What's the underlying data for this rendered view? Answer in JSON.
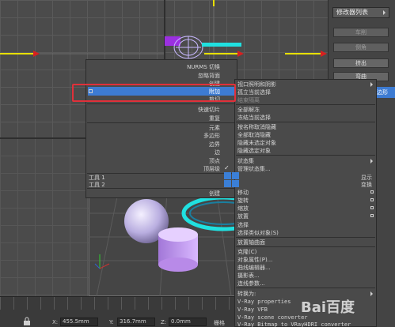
{
  "command_panel": {
    "title": "修改器列表",
    "buttons": [
      "车削",
      "倒角",
      "挤出",
      "弯曲"
    ],
    "highlight_text": "边形"
  },
  "quad_left": {
    "items": [
      {
        "label": "NURMS 切换"
      },
      {
        "label": "忽略背面"
      },
      {
        "label": "创建"
      },
      {
        "label": "附加",
        "selected": true
      },
      {
        "label": "剪切"
      },
      {
        "label": "快速切片"
      },
      {
        "label": "重复"
      },
      {
        "label": "元素"
      },
      {
        "label": "多边形"
      },
      {
        "label": "边界"
      },
      {
        "label": "边"
      },
      {
        "label": "顶点"
      },
      {
        "label": "顶层级"
      }
    ],
    "tool1": "工具 1",
    "tool2": "工具 2",
    "bottom": "创建"
  },
  "quad_right": {
    "top_items": [
      "视口照明和阴影",
      "孤立当前选择",
      "结束隔离",
      "全部解冻",
      "冻结当前选择",
      "按名称取消隐藏",
      "全部取消隐藏",
      "隐藏未选定对象",
      "隐藏选定对象",
      "状态集",
      "管理状态集..."
    ],
    "display": "显示",
    "transform": "变换",
    "bottom_items": [
      "移动",
      "旋转",
      "缩放",
      "放置",
      "选择",
      "选择类似对象(S)",
      "放置轴曲面",
      "克隆(C)",
      "对象属性(P)...",
      "曲线编辑器...",
      "摄影表...",
      "连线参数...",
      "转换为:",
      "V-Ray properties",
      "V-Ray VFB",
      "V-Ray scene converter",
      "V-Ray Bitmap to VRayHDRI converter"
    ]
  },
  "status": {
    "x_label": "X:",
    "x_value": "455.5mm",
    "y_label": "Y:",
    "y_value": "316.7mm",
    "z_label": "Z:",
    "z_value": "0.0mm",
    "grid_label": "栅格"
  },
  "watermark": "Bai百度",
  "colors": {
    "accent": "#3d7bd2",
    "highlight_box": "#e0303a",
    "viewport_bg": "#4b4b4b"
  }
}
